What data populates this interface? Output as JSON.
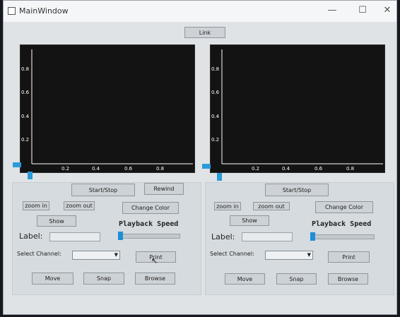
{
  "window": {
    "title": "MainWindow",
    "minimize": "—",
    "maximize": "☐",
    "close": "✕"
  },
  "toolbar": {
    "link_label": "Link"
  },
  "plots": [
    {
      "yticks": [
        "0.8",
        "0.6",
        "0.4",
        "0.2"
      ],
      "xticks": [
        "0.2",
        "0.4",
        "0.6",
        "0.8"
      ]
    },
    {
      "yticks": [
        "0.8",
        "0.6",
        "0.4",
        "0.2"
      ],
      "xticks": [
        "0.2",
        "0.4",
        "0.6",
        "0.8"
      ]
    }
  ],
  "panels": [
    {
      "start_stop": "Start/Stop",
      "rewind": "Rewind",
      "zoom_in": "zoom in",
      "zoom_out": "zoom out",
      "change_color": "Change Color",
      "show": "Show",
      "playback_speed": "Playback Speed",
      "label": "Label:",
      "label_value": "",
      "select_channel": "Select Channel:",
      "channel_value": "",
      "print": "Print",
      "move": "Move",
      "snap": "Snap",
      "browse": "Browse"
    },
    {
      "start_stop": "Start/Stop",
      "zoom_in": "zoom in",
      "zoom_out": "zoom out",
      "change_color": "Change Color",
      "show": "Show",
      "playback_speed": "Playback Speed",
      "label": "Label:",
      "label_value": "",
      "select_channel": "Select Channel:",
      "channel_value": "",
      "print": "Print",
      "move": "Move",
      "snap": "Snap",
      "browse": "Browse"
    }
  ],
  "colors": {
    "plot_bg": "#131313",
    "axis": "#ffffff",
    "slider_accent": "#1e8fd6"
  }
}
